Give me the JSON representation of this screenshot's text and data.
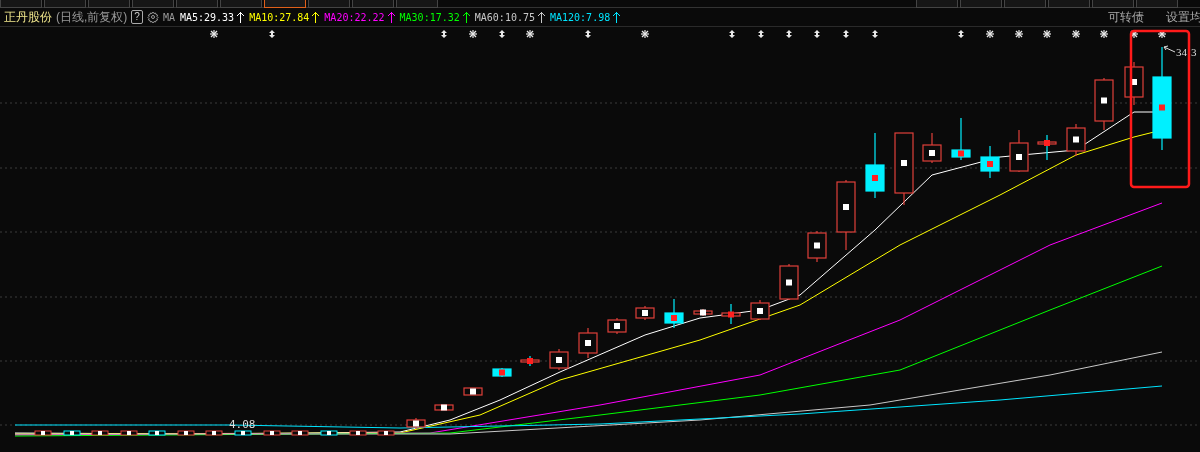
{
  "top_tabs": [
    {
      "selected": false
    },
    {
      "selected": false
    },
    {
      "selected": false
    },
    {
      "selected": false
    },
    {
      "selected": false
    },
    {
      "selected": false
    },
    {
      "selected": true
    },
    {
      "selected": false
    },
    {
      "selected": false
    },
    {
      "selected": false
    },
    {
      "selected": false
    },
    {
      "selected": false
    },
    {
      "selected": false
    },
    {
      "selected": false
    },
    {
      "selected": false
    },
    {
      "selected": false
    }
  ],
  "stock": {
    "name": "正丹股份",
    "mode": "(日线,前复权)",
    "help": "?",
    "ma_label": "MA"
  },
  "ma_lines": [
    {
      "label": "MA5:29.33",
      "color": "#ffffff"
    },
    {
      "label": "MA10:27.84",
      "color": "#ffff00"
    },
    {
      "label": "MA20:22.22",
      "color": "#ff00ff"
    },
    {
      "label": "MA30:17.32",
      "color": "#00ff00"
    },
    {
      "label": "MA60:10.75",
      "color": "#c8c8c8"
    },
    {
      "label": "MA120:7.98",
      "color": "#00e5ff"
    }
  ],
  "right_links": [
    "可转债",
    "设置均"
  ],
  "chart": {
    "high_label": "34",
    "high_label_cut": "3",
    "low_label": "4.08"
  }
}
